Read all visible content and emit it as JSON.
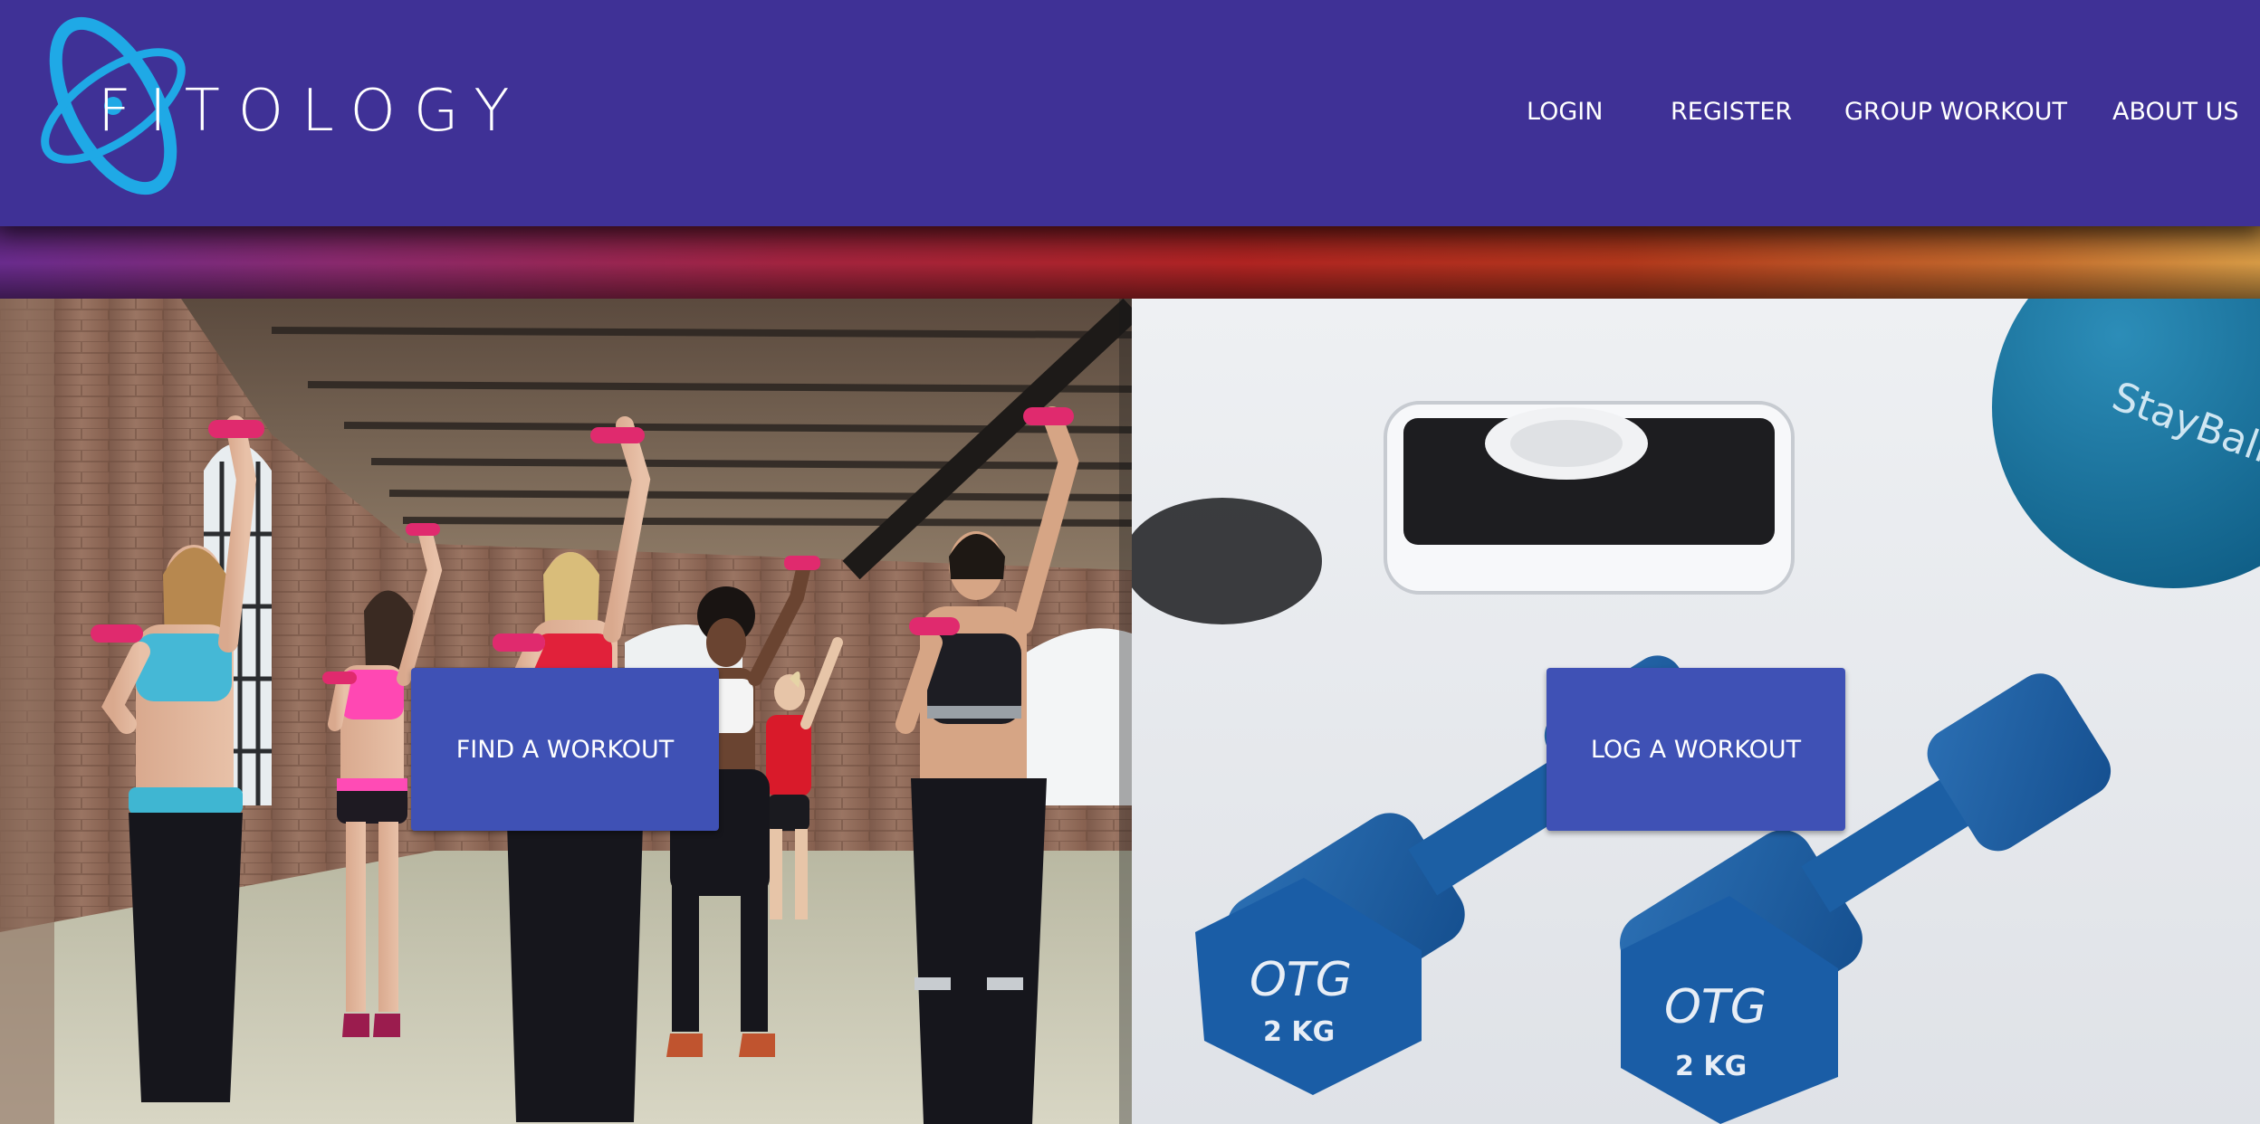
{
  "brand": {
    "name": "FITOLOGY"
  },
  "nav": {
    "login": "LOGIN",
    "register": "REGISTER",
    "group_workout": "GROUP WORKOUT",
    "about_us": "ABOUT US"
  },
  "actions": {
    "find_workout": "FIND A WORKOUT",
    "log_workout": "LOG A WORKOUT"
  },
  "images": {
    "left": "group-workout-dumbbells-photo",
    "right": "dumbbells-scale-ball-photo",
    "dumbbell_label": "2 KG",
    "dumbbell_brand": "OTG",
    "ball_label": "StayBall"
  },
  "colors": {
    "header": "#3f3196",
    "button": "#3f51b5",
    "logo_accent": "#1fa9e6"
  }
}
